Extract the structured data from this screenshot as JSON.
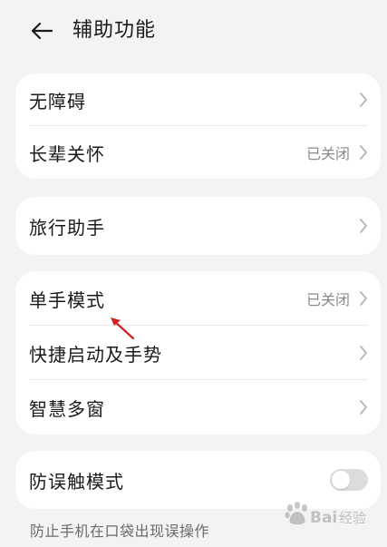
{
  "header": {
    "back_icon": "arrow-left-icon",
    "title": "辅助功能"
  },
  "card1": {
    "items": [
      {
        "label": "无障碍",
        "value": ""
      },
      {
        "label": "长辈关怀",
        "value": "已关闭"
      }
    ]
  },
  "card2": {
    "items": [
      {
        "label": "旅行助手",
        "value": ""
      }
    ]
  },
  "card3": {
    "items": [
      {
        "label": "单手模式",
        "value": "已关闭"
      },
      {
        "label": "快捷启动及手势",
        "value": ""
      },
      {
        "label": "智慧多窗",
        "value": ""
      }
    ]
  },
  "card4": {
    "label": "防误触模式",
    "toggle_on": false
  },
  "footnote": "防止手机在口袋出现误操作",
  "watermark": {
    "text": "Baidu经验"
  },
  "colors": {
    "background": "#f1f3f5",
    "card": "#ffffff",
    "secondary_text": "#8a8a8a",
    "annotation_arrow": "#d32020"
  }
}
